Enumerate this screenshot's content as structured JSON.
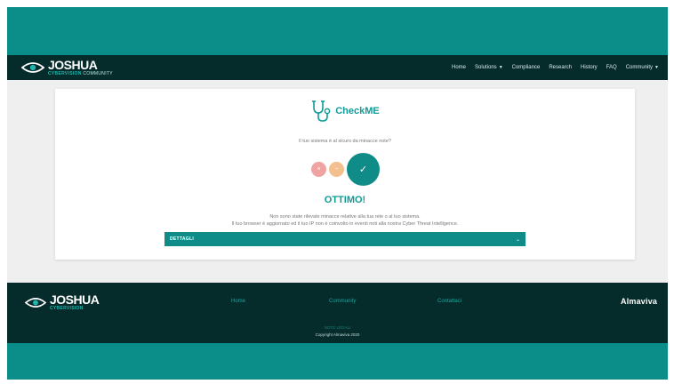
{
  "header": {
    "logo_name": "JOSHUA",
    "logo_sub_strong": "CYBERVISION",
    "logo_sub_rest": " COMMUNITY",
    "menu": {
      "home": "Home",
      "solutions": "Solutions",
      "compliance": "Compliance",
      "research": "Research",
      "history": "History",
      "faq": "FAQ",
      "community": "Community"
    }
  },
  "card": {
    "brand": "CheckME",
    "question": "Il tuo sistema è al sicuro da minacce note?",
    "verdict": "OTTIMO!",
    "message_line1": "Non sono state rilevate minacce relative alla tua rete o al tuo sistema.",
    "message_line2": "Il tuo browser è aggiornato ed il tuo IP non è coinvolto in eventi noti alla nostra Cyber Threat Intelligence.",
    "details_label": "DETTAGLI",
    "status_icons": {
      "red": "close-icon",
      "orange": "minus-icon",
      "green": "check-icon"
    }
  },
  "footer": {
    "logo_name": "JOSHUA",
    "logo_sub": "CYBERVISION",
    "links": {
      "home": "Home",
      "community": "Community",
      "contacts": "Contattaci"
    },
    "brand": "Almaviva",
    "legal": "NOTE LEGALI",
    "copyright": "Copyright Almaviva 2020"
  },
  "colors": {
    "teal": "#0b8d89",
    "dark": "#052b2b",
    "accent": "#119c97",
    "status_red": "#f0a3a3",
    "status_orange": "#f3bf8f",
    "status_green": "#0f8c88"
  }
}
